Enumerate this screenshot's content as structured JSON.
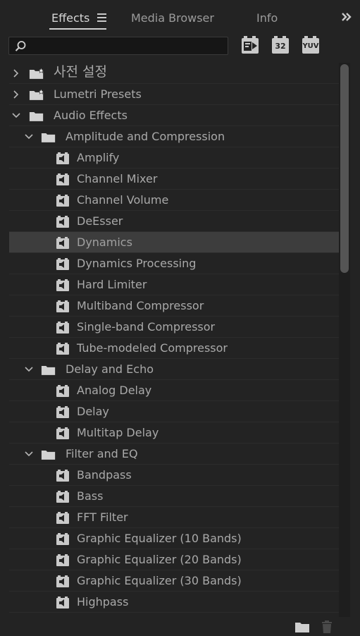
{
  "tabs": {
    "effects": "Effects",
    "media_browser": "Media Browser",
    "info": "Info"
  },
  "search": {
    "value": "",
    "placeholder": ""
  },
  "filters": {
    "accelerated": "fx",
    "bit32": "32",
    "yuv": "YUV"
  },
  "tree": [
    {
      "label": "사전 설정",
      "level": 0,
      "kind": "bin-star",
      "expanded": false
    },
    {
      "label": "Lumetri Presets",
      "level": 0,
      "kind": "bin-star",
      "expanded": false
    },
    {
      "label": "Audio Effects",
      "level": 0,
      "kind": "bin",
      "expanded": true
    },
    {
      "label": "Amplitude and Compression",
      "level": 1,
      "kind": "bin",
      "expanded": true
    },
    {
      "label": "Amplify",
      "level": 2,
      "kind": "effect"
    },
    {
      "label": "Channel Mixer",
      "level": 2,
      "kind": "effect"
    },
    {
      "label": "Channel Volume",
      "level": 2,
      "kind": "effect"
    },
    {
      "label": "DeEsser",
      "level": 2,
      "kind": "effect"
    },
    {
      "label": "Dynamics",
      "level": 2,
      "kind": "effect",
      "selected": true
    },
    {
      "label": "Dynamics Processing",
      "level": 2,
      "kind": "effect"
    },
    {
      "label": "Hard Limiter",
      "level": 2,
      "kind": "effect"
    },
    {
      "label": "Multiband Compressor",
      "level": 2,
      "kind": "effect"
    },
    {
      "label": "Single-band Compressor",
      "level": 2,
      "kind": "effect"
    },
    {
      "label": "Tube-modeled Compressor",
      "level": 2,
      "kind": "effect"
    },
    {
      "label": "Delay and Echo",
      "level": 1,
      "kind": "bin",
      "expanded": true
    },
    {
      "label": "Analog Delay",
      "level": 2,
      "kind": "effect"
    },
    {
      "label": "Delay",
      "level": 2,
      "kind": "effect"
    },
    {
      "label": "Multitap Delay",
      "level": 2,
      "kind": "effect"
    },
    {
      "label": "Filter and EQ",
      "level": 1,
      "kind": "bin",
      "expanded": true
    },
    {
      "label": "Bandpass",
      "level": 2,
      "kind": "effect"
    },
    {
      "label": "Bass",
      "level": 2,
      "kind": "effect"
    },
    {
      "label": "FFT Filter",
      "level": 2,
      "kind": "effect"
    },
    {
      "label": "Graphic Equalizer (10 Bands)",
      "level": 2,
      "kind": "effect"
    },
    {
      "label": "Graphic Equalizer (20 Bands)",
      "level": 2,
      "kind": "effect"
    },
    {
      "label": "Graphic Equalizer (30 Bands)",
      "level": 2,
      "kind": "effect"
    },
    {
      "label": "Highpass",
      "level": 2,
      "kind": "effect"
    },
    {
      "label": "",
      "level": 2,
      "kind": "effect"
    }
  ],
  "icons": {
    "tab_menu": "hamburger-menu-icon",
    "overflow": "chevron-double-right-icon",
    "search": "search-icon",
    "new_bin": "folder-icon",
    "delete": "trash-icon"
  },
  "colors": {
    "background": "#232323",
    "selected_row": "#3d3d3d",
    "text": "#a9a9a9",
    "active_tab": "#d6d6d6"
  }
}
